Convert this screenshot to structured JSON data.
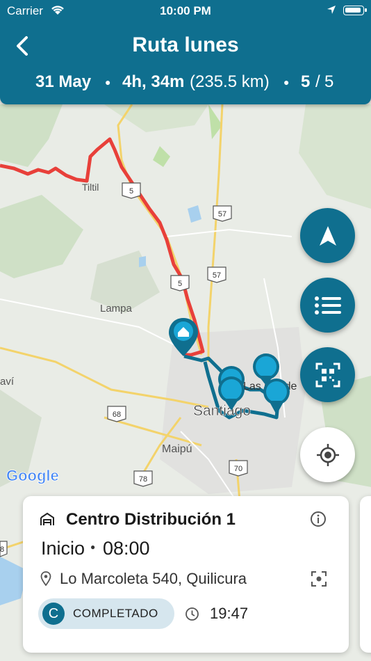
{
  "status_bar": {
    "carrier": "Carrier",
    "time": "10:00 PM"
  },
  "header": {
    "title": "Ruta lunes",
    "date": "31 May",
    "duration": "4h, 34m",
    "distance": "(235.5 km)",
    "stops_done": "5",
    "stops_sep": "/",
    "stops_total": "5"
  },
  "map": {
    "labels": {
      "tiltil": "Tiltil",
      "lampa": "Lampa",
      "santiago": "Santiago",
      "maipu": "Maipú",
      "lascondes": "Las Conde",
      "curacavi": "aví"
    },
    "shields": {
      "r5a": "5",
      "r5b": "5",
      "r57a": "57",
      "r57b": "57",
      "r68": "68",
      "r70": "70",
      "r78": "78",
      "r8": "8"
    },
    "attribution": "Google",
    "colors": {
      "route_pending": "#e8403a",
      "route_done": "#0f6f8f",
      "pin": "#1aa6d6"
    }
  },
  "fabs": [
    "navigation-icon",
    "list-icon",
    "qr-scan-icon",
    "my-location-icon"
  ],
  "card": {
    "name": "Centro Distribución 1",
    "label": "Inicio",
    "scheduled_time": "08:00",
    "address": "Lo Marcoleta 540, Quilicura",
    "status_letter": "C",
    "status": "COMPLETADO",
    "completed_time": "19:47"
  },
  "theme": {
    "primary": "#0f6f8f",
    "accent": "#1aa6d6",
    "route_red": "#e8403a"
  }
}
